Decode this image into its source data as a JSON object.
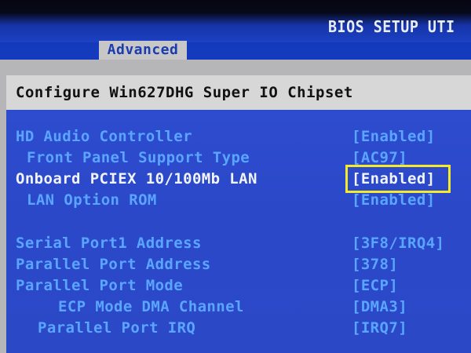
{
  "header": {
    "title": "BIOS SETUP UTI",
    "active_tab": "Advanced"
  },
  "section": {
    "title": "Configure Win627DHG Super IO Chipset"
  },
  "settings": [
    {
      "label": "HD Audio Controller",
      "value": "[Enabled]",
      "indent": 0,
      "selected": false
    },
    {
      "label": "Front Panel Support Type",
      "value": "[AC97]",
      "indent": 1,
      "selected": false
    },
    {
      "label": "Onboard PCIEX 10/100Mb LAN",
      "value": "[Enabled]",
      "indent": 0,
      "selected": true
    },
    {
      "label": "LAN Option ROM",
      "value": "[Enabled]",
      "indent": 1,
      "selected": false
    },
    {
      "label": "Serial Port1 Address",
      "value": "[3F8/IRQ4]",
      "indent": 0,
      "selected": false
    },
    {
      "label": "Parallel Port Address",
      "value": "[378]",
      "indent": 0,
      "selected": false
    },
    {
      "label": "Parallel Port Mode",
      "value": "[ECP]",
      "indent": 0,
      "selected": false
    },
    {
      "label": "ECP Mode DMA Channel",
      "value": "[DMA3]",
      "indent": 2,
      "selected": false
    },
    {
      "label": "Parallel Port IRQ",
      "value": "[IRQ7]",
      "indent": 1,
      "selected": false
    }
  ],
  "colors": {
    "background": "#1240b8",
    "tab_background": "#c7c7c7",
    "item_text": "#5aa5ff",
    "selected_text": "#f2f4fb",
    "highlight_border": "#f4ea29"
  }
}
